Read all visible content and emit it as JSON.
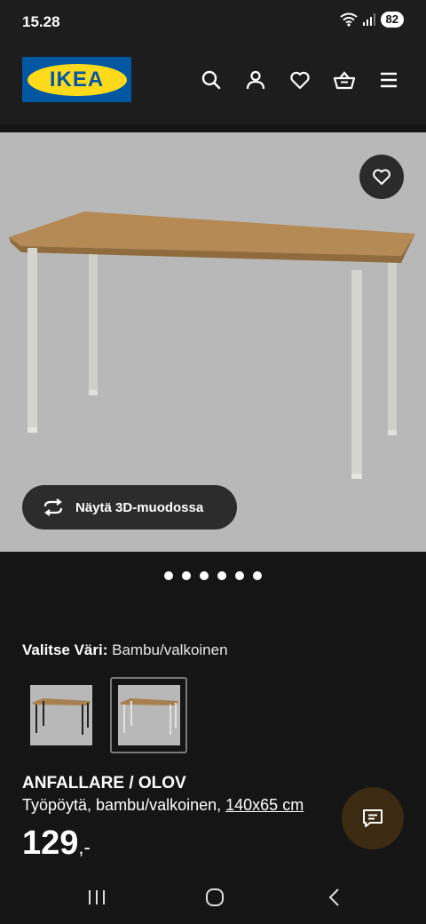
{
  "status_bar": {
    "time": "15.28",
    "battery": "82",
    "icons": [
      "wifi-icon",
      "signal-icon"
    ]
  },
  "header": {
    "logo_text": "IKEA",
    "icons": [
      "search-icon",
      "profile-icon",
      "heart-icon",
      "cart-icon",
      "menu-icon"
    ]
  },
  "gallery": {
    "view3d_label": "Näytä 3D-muodossa",
    "dot_count": 6,
    "favorite_icon": "heart-icon"
  },
  "product": {
    "color_label": "Valitse Väri:",
    "color_value": "Bambu/valkoinen",
    "swatches": [
      "bamboo-black",
      "bamboo-white"
    ],
    "name": "ANFALLARE / OLOV",
    "desc_text": "Työpöytä, bambu/valkoinen, ",
    "desc_size": "140x65 cm",
    "price": "129",
    "price_suffix": ",-"
  },
  "chat": {
    "icon": "chat-icon"
  },
  "nav": {
    "icons": [
      "recent-apps-icon",
      "home-icon",
      "back-icon"
    ]
  },
  "colors": {
    "header_bg": "#1d1d1d",
    "page_bg": "#151515",
    "gallery_bg": "#b8b8b8",
    "logo_blue": "#0058a3",
    "logo_yellow": "#ffda1a"
  }
}
